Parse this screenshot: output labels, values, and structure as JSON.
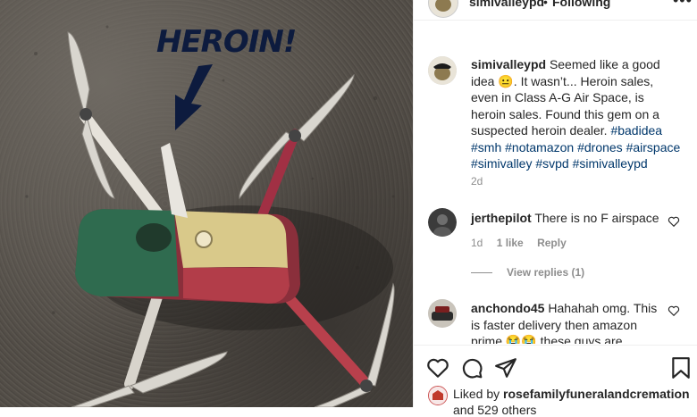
{
  "photo": {
    "overlay_text": "HEROIN!",
    "colors": {
      "arrow": "#0d1b3e",
      "green_band": "#2f6b4f",
      "white_band": "#d9c98a",
      "red_band": "#b8404c",
      "body": "#8a2f3b",
      "propeller": "#d9d6cf"
    }
  },
  "header": {
    "username": "simivalleypd",
    "separator": "•",
    "follow_status": "Following",
    "more_icon": "more-horizontal-icon"
  },
  "caption": {
    "username": "simivalleypd",
    "text_before_emoji": "Seemed like a good idea",
    "emoji": "😐",
    "text_after_emoji": ". It wasn’t... Heroin sales, even in Class A-G Air Space, is heroin sales. Found this gem on a suspected heroin dealer.",
    "hashtags": [
      "#badidea",
      "#smh",
      "#notamazon",
      "#drones",
      "#airspace",
      "#simivalley",
      "#svpd",
      "#simivalleypd"
    ],
    "time": "2d"
  },
  "comments": [
    {
      "username": "jerthepilot",
      "text": "There is no F airspace",
      "time": "1d",
      "likes": "1 like",
      "reply_label": "Reply",
      "view_replies": "View replies (1)"
    },
    {
      "username": "anchondo45",
      "text": "Hahahah omg. This is faster delivery then amazon prime 😭😭 these guys are"
    }
  ],
  "actions": {
    "icons": [
      "heart-icon",
      "comment-icon",
      "share-icon",
      "bookmark-icon"
    ],
    "liked_by_prefix": "Liked by",
    "liked_by_user": "rosefamilyfuneralandcremation",
    "others": "and 529 others"
  }
}
